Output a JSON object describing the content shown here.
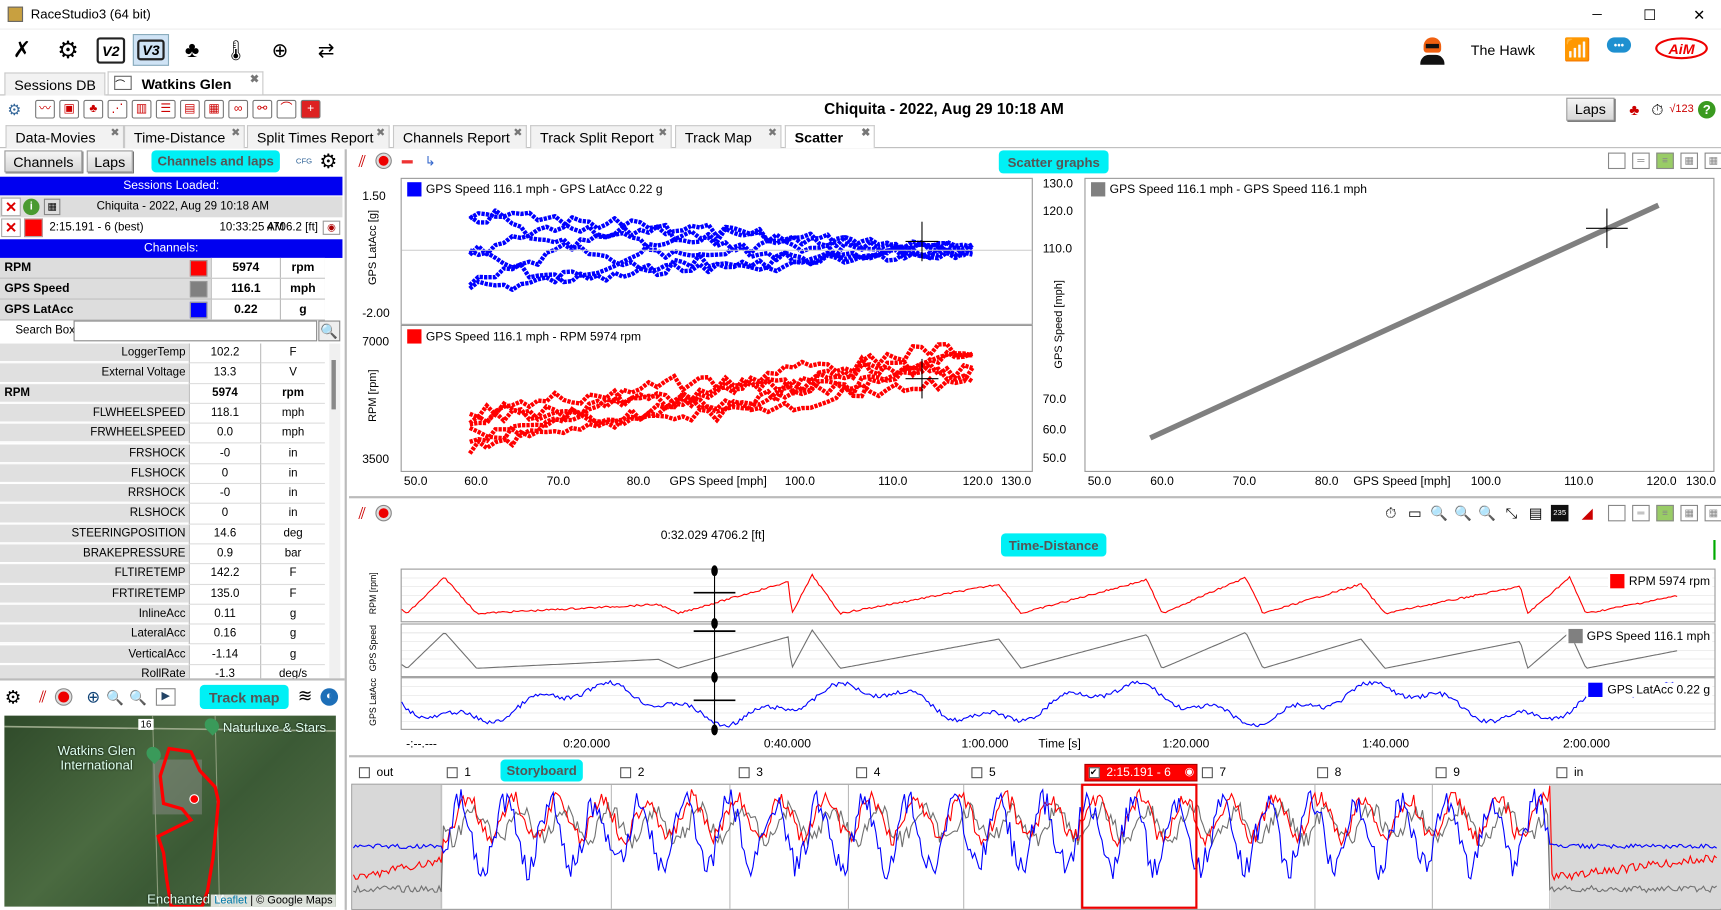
{
  "window": {
    "title": "RaceStudio3 (64 bit)",
    "minimize": "─",
    "maximize": "☐",
    "close": "✕"
  },
  "toolbar": {
    "icons": [
      "wrench-icon",
      "gear-icon",
      "v2-icon",
      "v3-icon",
      "track-icon",
      "temperature-icon",
      "add-device-icon",
      "transfer-icon"
    ],
    "v2": "V2",
    "v3": "V3",
    "user": "The Hawk"
  },
  "session_tabs": [
    {
      "label": "Sessions DB"
    },
    {
      "label": "Watkins Glen",
      "active": true
    }
  ],
  "analysis": {
    "title": "Chiquita - 2022, Aug 29 10:18 AM",
    "laps_button": "Laps"
  },
  "tabs": [
    {
      "label": "Data-Movies"
    },
    {
      "label": "Time-Distance"
    },
    {
      "label": "Split Times Report"
    },
    {
      "label": "Channels Report"
    },
    {
      "label": "Track Split Report"
    },
    {
      "label": "Track Map"
    },
    {
      "label": "Scatter",
      "active": true
    }
  ],
  "left": {
    "channels_button": "Channels",
    "laps_button": "Laps",
    "panel_label": "Channels and laps",
    "cfg": "CFG",
    "sessions_header": "Sessions Loaded:",
    "session": "Chiquita - 2022, Aug 29 10:18 AM",
    "lap": {
      "name": "2:15.191 - 6 (best)",
      "time": "10:33:25 AM",
      "distance": "4706.2 [ft]",
      "color": "#ff0000"
    },
    "channels_header": "Channels:",
    "selected": [
      {
        "name": "RPM",
        "color": "#ff0000",
        "value": "5974",
        "unit": "rpm"
      },
      {
        "name": "GPS Speed",
        "color": "#808080",
        "value": "116.1",
        "unit": "mph"
      },
      {
        "name": "GPS LatAcc",
        "color": "#0000ff",
        "value": "0.22",
        "unit": "g"
      }
    ],
    "search_label": "Search Box",
    "search_value": "",
    "list": [
      {
        "name": "LoggerTemp",
        "value": "102.2",
        "unit": "F"
      },
      {
        "name": "External Voltage",
        "value": "13.3",
        "unit": "V"
      },
      {
        "name": "RPM",
        "value": "5974",
        "unit": "rpm",
        "bold": true
      },
      {
        "name": "FLWHEELSPEED",
        "value": "118.1",
        "unit": "mph"
      },
      {
        "name": "FRWHEELSPEED",
        "value": "0.0",
        "unit": "mph"
      },
      {
        "name": "FRSHOCK",
        "value": "-0",
        "unit": "in"
      },
      {
        "name": "FLSHOCK",
        "value": "0",
        "unit": "in"
      },
      {
        "name": "RRSHOCK",
        "value": "-0",
        "unit": "in"
      },
      {
        "name": "RLSHOCK",
        "value": "0",
        "unit": "in"
      },
      {
        "name": "STEERINGPOSITION",
        "value": "14.6",
        "unit": "deg"
      },
      {
        "name": "BRAKEPRESSURE",
        "value": "0.9",
        "unit": "bar"
      },
      {
        "name": "FLTIRETEMP",
        "value": "142.2",
        "unit": "F"
      },
      {
        "name": "FRTIRETEMP",
        "value": "135.0",
        "unit": "F"
      },
      {
        "name": "InlineAcc",
        "value": "0.11",
        "unit": "g"
      },
      {
        "name": "LateralAcc",
        "value": "0.16",
        "unit": "g"
      },
      {
        "name": "VerticalAcc",
        "value": "-1.14",
        "unit": "g"
      },
      {
        "name": "RollRate",
        "value": "-1.3",
        "unit": "deg/s"
      }
    ],
    "trackmap_label": "Track map",
    "map": {
      "labels": [
        "Naturluxe & Stars",
        "Watkins Glen International",
        "Enchanted M..."
      ],
      "road": "16",
      "attribution_leaflet": "Leaflet",
      "attribution_google": "| © Google Maps"
    }
  },
  "scatter": {
    "label": "Scatter graphs",
    "top": {
      "legend_x": "GPS Speed  116.1 mph  -  GPS LatAcc   0.22  g",
      "ylabel": "GPS LatAcc [g]",
      "yticks": [
        "1.50",
        "-2.00"
      ]
    },
    "bottom": {
      "legend_x": "GPS Speed  116.1 mph  -  RPM   5974  rpm",
      "ylabel": "RPM [rpm]",
      "yticks": [
        "7000",
        "3500"
      ]
    },
    "right": {
      "legend": "GPS Speed  116.1 mph  -  GPS Speed    116.1  mph",
      "ylabel": "GPS Speed [mph]",
      "yticks": [
        "130.0",
        "120.0",
        "110.0",
        "70.0",
        "60.0",
        "50.0"
      ]
    },
    "xticks": [
      "50.0",
      "60.0",
      "70.0",
      "80.0",
      "100.0",
      "110.0",
      "120.0",
      "130.0"
    ],
    "xlabel": "GPS Speed [mph]"
  },
  "time_distance": {
    "label": "Time-Distance",
    "cursor": "0:32.029   4706.2 [ft]",
    "rows": [
      {
        "ylabel": "RPM [rpm]",
        "legend": "RPM  5974  rpm",
        "color": "#ff0000"
      },
      {
        "ylabel": "GPS Speed",
        "legend": "GPS Speed  116.1  mph",
        "color": "#808080"
      },
      {
        "ylabel": "GPS LatAcc",
        "legend": "GPS LatAcc  0.22  g",
        "color": "#0000ff"
      }
    ],
    "xticks": [
      "-:--.---",
      "0:20.000",
      "0:40.000",
      "1:00.000",
      "1:20.000",
      "1:40.000",
      "2:00.000"
    ],
    "xlabel": "Time [s]",
    "badge": "235"
  },
  "storyboard": {
    "label": "Storyboard",
    "laps": [
      "out",
      "1",
      "2",
      "3",
      "4",
      "5",
      "2:15.191 - 6",
      "7",
      "8",
      "9",
      "in"
    ],
    "selected_lap": "2:15.191 - 6"
  }
}
